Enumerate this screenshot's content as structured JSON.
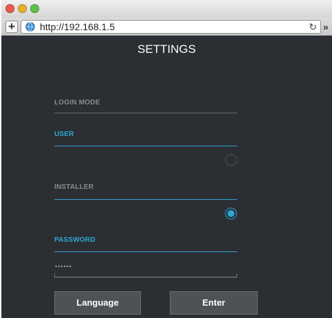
{
  "browser": {
    "add_button": "+",
    "url": "http://192.168.1.5",
    "reload_icon": "reload-icon",
    "more_button": "»"
  },
  "settings": {
    "title": "SETTINGS",
    "login_mode_label": "LOGIN MODE",
    "user_label": "USER",
    "user_selected": false,
    "installer_label": "INSTALLER",
    "installer_selected": true,
    "password_label": "PASSWORD",
    "password_value": "••••••"
  },
  "buttons": {
    "language": "Language",
    "enter": "Enter"
  },
  "colors": {
    "background": "#2b2e32",
    "accent": "#2ea7d8",
    "muted_label": "#8a8d90",
    "button": "#4e5256"
  }
}
